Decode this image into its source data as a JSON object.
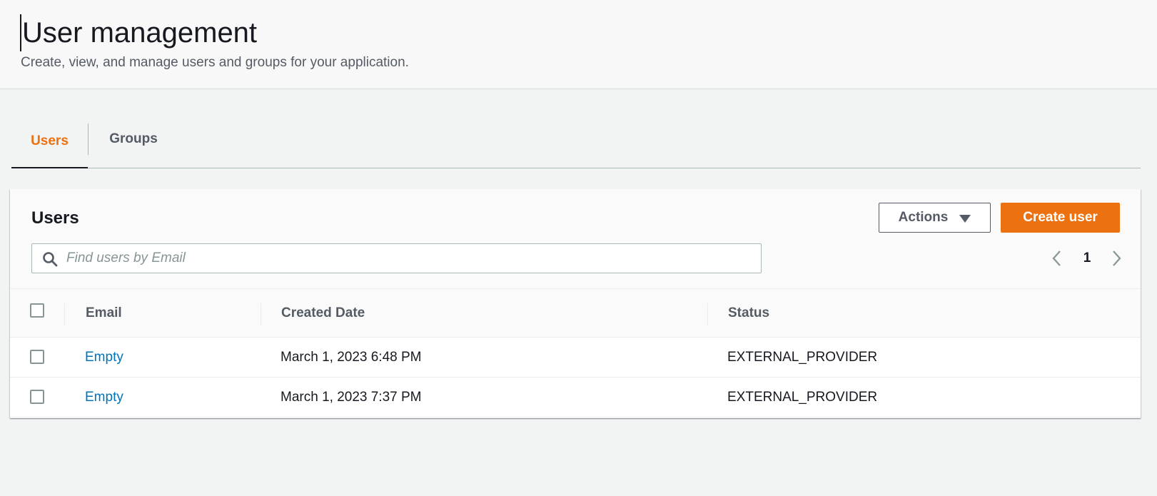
{
  "header": {
    "title": "User management",
    "subtitle": "Create, view, and manage users and groups for your application."
  },
  "tabs": [
    {
      "label": "Users",
      "active": true
    },
    {
      "label": "Groups",
      "active": false
    }
  ],
  "panel": {
    "title": "Users",
    "actions_label": "Actions",
    "create_label": "Create user",
    "search": {
      "placeholder": "Find users by Email",
      "value": ""
    },
    "pagination": {
      "current_page": "1"
    }
  },
  "table": {
    "columns": [
      "Email",
      "Created Date",
      "Status"
    ],
    "rows": [
      {
        "email": "Empty",
        "created": "March 1, 2023 6:48 PM",
        "status": "EXTERNAL_PROVIDER"
      },
      {
        "email": "Empty",
        "created": "March 1, 2023 7:37 PM",
        "status": "EXTERNAL_PROVIDER"
      }
    ]
  },
  "colors": {
    "accent": "#ec7211",
    "link": "#0073bb",
    "background": "#f2f3f3",
    "text_secondary": "#545b64"
  },
  "icons": {
    "search": "search-icon",
    "actions_caret": "caret-down-icon",
    "prev": "chevron-left-icon",
    "next": "chevron-right-icon"
  }
}
